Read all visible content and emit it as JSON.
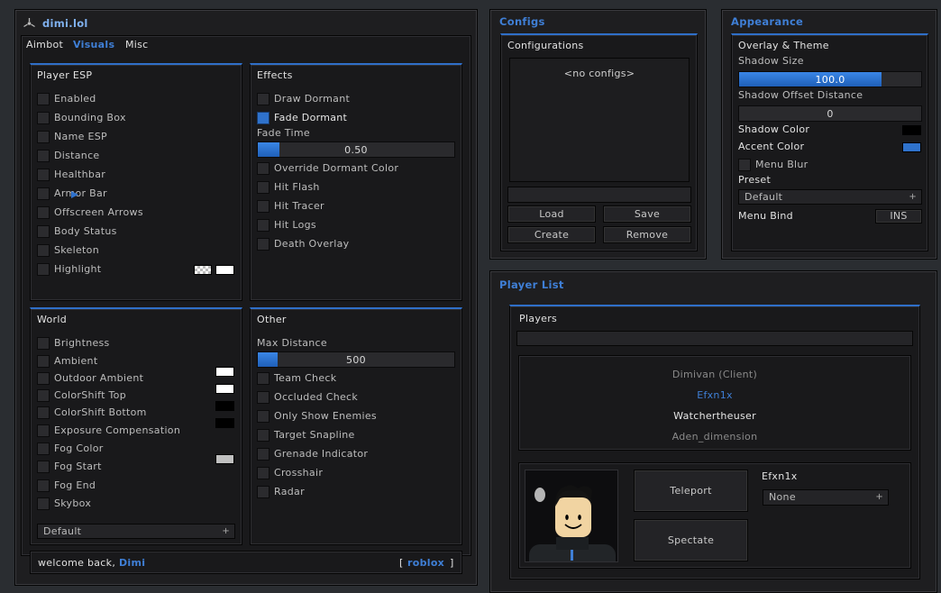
{
  "main": {
    "title": "dimi.lol",
    "tabs": [
      {
        "label": "Aimbot"
      },
      {
        "label": "Visuals"
      },
      {
        "label": "Misc"
      }
    ],
    "player_esp": {
      "title": "Player ESP",
      "items": [
        "Enabled",
        "Bounding Box",
        "Name ESP",
        "Distance",
        "Healthbar",
        "Armor Bar",
        "Offscreen Arrows",
        "Body Status",
        "Skeleton",
        "Highlight"
      ]
    },
    "effects": {
      "title": "Effects",
      "draw_dormant": "Draw Dormant",
      "fade_dormant": "Fade Dormant",
      "fade_time_label": "Fade Time",
      "fade_time_value": "0.50",
      "fade_time_fraction": 0.11,
      "items": [
        "Override Dormant Color",
        "Hit Flash",
        "Hit Tracer",
        "Hit Logs",
        "Death Overlay"
      ]
    },
    "world": {
      "title": "World",
      "items": [
        "Brightness",
        "Ambient",
        "Outdoor Ambient",
        "ColorShift Top",
        "ColorShift Bottom",
        "Exposure Compensation",
        "Fog Color",
        "Fog Start",
        "Fog End",
        "Skybox"
      ],
      "skybox_value": "Default",
      "colors": {
        "ambient": "#ffffff",
        "outdoor_ambient": "#ffffff",
        "colorshift_top": "#000000",
        "colorshift_bottom": "#000000",
        "fog_color": "#c0c0c0"
      }
    },
    "other": {
      "title": "Other",
      "max_distance_label": "Max Distance",
      "max_distance_value": "500",
      "max_distance_fraction": 0.1,
      "items": [
        "Team Check",
        "Occluded Check",
        "Only Show Enemies",
        "Target Snapline",
        "Grenade Indicator",
        "Crosshair",
        "Radar"
      ]
    },
    "status": {
      "welcome": "welcome back,",
      "user": "Dimi",
      "bracket_open": "[",
      "game": "roblox",
      "bracket_close": "]"
    }
  },
  "configs": {
    "title": "Configs",
    "section": "Configurations",
    "empty": "<no configs>",
    "buttons": {
      "load": "Load",
      "save": "Save",
      "create": "Create",
      "remove": "Remove"
    }
  },
  "appearance": {
    "title": "Appearance",
    "section": "Overlay & Theme",
    "shadow_size_label": "Shadow Size",
    "shadow_size_value": "100.0",
    "shadow_size_fraction": 0.78,
    "shadow_offset_label": "Shadow Offset Distance",
    "shadow_offset_value": "0",
    "shadow_color_label": "Shadow Color",
    "accent_color_label": "Accent Color",
    "menu_blur_label": "Menu Blur",
    "preset_label": "Preset",
    "preset_value": "Default",
    "menu_bind_label": "Menu Bind",
    "menu_bind_value": "INS",
    "colors": {
      "shadow": "#000000",
      "accent": "#2f72cc"
    }
  },
  "player_list": {
    "title_a": "Player",
    "title_b": "List",
    "section": "Players",
    "players": [
      "Dimivan (Client)",
      "Efxn1x",
      "Watchertheuser",
      "Aden_dimension"
    ],
    "teleport": "Teleport",
    "spectate": "Spectate",
    "selected_name": "Efxn1x",
    "selected_value": "None"
  },
  "accent": "#3f7fd6"
}
